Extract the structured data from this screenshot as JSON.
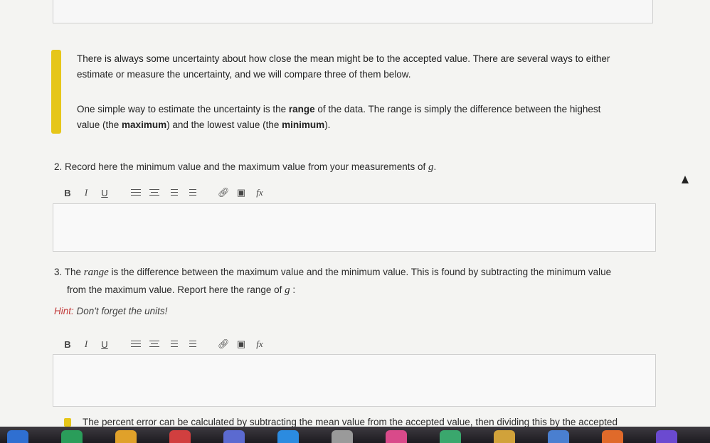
{
  "callout": {
    "line1": "There is always some uncertainty about how close the mean might be to the accepted value. There are several ways to either",
    "line2": "estimate or measure the uncertainty, and we will compare three of them below.",
    "line3_pre": "One simple way to estimate the uncertainty is the ",
    "line3_bold": "range",
    "line3_post": " of the data. The range is simply the difference between the highest",
    "line4_pre": "value (the ",
    "line4_bold1": "maximum",
    "line4_mid": ") and the lowest value (the ",
    "line4_bold2": "minimum",
    "line4_post": ")."
  },
  "question2": {
    "text": "2. Record here the minimum value and the maximum value from your measurements of ",
    "var": "g",
    "end": "."
  },
  "toolbar": {
    "bold": "B",
    "italic": "I",
    "underline": "U",
    "formula": "fx"
  },
  "question3": {
    "pre": "3. The ",
    "term": "range",
    "post": " is the difference between the maximum value and the minimum value. This is found by subtracting the minimum value",
    "line2": "from the maximum value. Report  here the range of ",
    "var": "g",
    "end": " :",
    "hint_label": "Hint:",
    "hint_text": " Don't forget the units!"
  },
  "bottom": {
    "text": "The percent error can be calculated by subtracting the mean value from the accepted value, then dividing this by the accepted"
  },
  "colors": {
    "accent": "#e6c619",
    "hint": "#c23a3a"
  },
  "dock_icons": [
    "#2f6fd1",
    "#2a9d5a",
    "#e0a12a",
    "#d13f3f",
    "#5b6ad0",
    "#2b8be0",
    "#9a9a9a",
    "#d94a8a",
    "#3aa76d",
    "#d1a23a",
    "#4a7fd0",
    "#e06a2a",
    "#6b4ad0"
  ]
}
